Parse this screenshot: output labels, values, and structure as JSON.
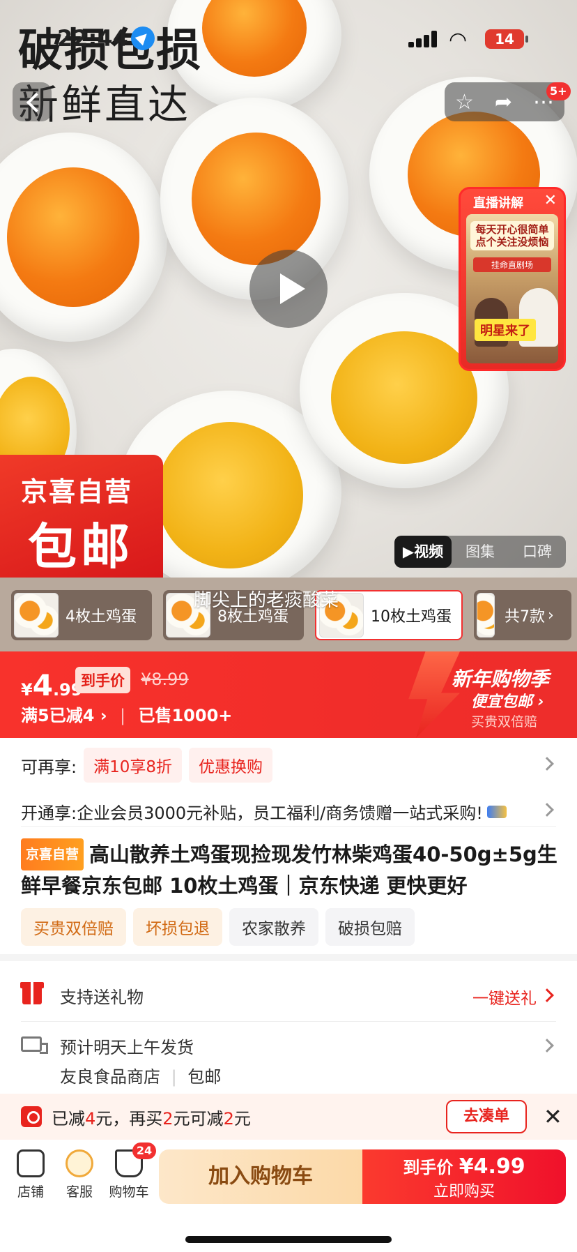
{
  "status_bar": {
    "time": "22:44",
    "battery": "14"
  },
  "hero": {
    "title_line1": "破损包损",
    "title_line2": "新鲜直达",
    "badge_count": "5+",
    "live_card": {
      "header": "直播讲解",
      "tag1": "每天开心很简单 点个关注没烦恼",
      "tag2": "挂命直剧场",
      "banner": "明星来了"
    },
    "promo_badge_line1": "京喜自营",
    "promo_badge_line2": "包邮",
    "media_tabs": [
      "▶视频",
      "图集",
      "口碑"
    ]
  },
  "variants": {
    "items": [
      "4枚土鸡蛋",
      "8枚土鸡蛋",
      "10枚土鸡蛋"
    ],
    "more": "共7款",
    "overlay_text": "脚尖上的老痰酸菜"
  },
  "price": {
    "currency": "¥",
    "integer": "4",
    "decimal": ".99",
    "tag": "到手价",
    "original": "¥8.99",
    "discount_rule": "满5已减4",
    "sold": "已售1000+",
    "festival_title": "新年购物季",
    "festival_sub": "便宜包邮",
    "festival_sub2": "买贵双倍赔"
  },
  "info": {
    "benefit_label": "可再享:",
    "benefit_pills": [
      "满10享8折",
      "优惠换购"
    ],
    "vip_text": "开通享:企业会员3000元补贴，员工福利/商务馈赠一站式采购!",
    "title_tag": "京喜自营",
    "title": "高山散养土鸡蛋现捡现发竹林柴鸡蛋40-50g±5g生鲜早餐京东包邮 10枚土鸡蛋｜京东快递 更快更好",
    "feature_tags": [
      "买贵双倍赔",
      "坏损包退",
      "农家散养",
      "破损包赔"
    ]
  },
  "service": {
    "gift_label": "支持送礼物",
    "gift_action": "一键送礼",
    "ship_label": "预计明天上午发货",
    "store": "友良食品商店",
    "shipping_fee": "包邮"
  },
  "coupon": {
    "text_prefix": "已减",
    "amount1": "4",
    "text_mid": "元，再买",
    "amount2": "2",
    "text_mid2": "元可减",
    "amount3": "2",
    "text_suffix": "元",
    "button": "去凑单"
  },
  "bottom": {
    "store": "店铺",
    "service": "客服",
    "cart": "购物车",
    "cart_count": "24",
    "add_cart": "加入购物车",
    "buy_price_label": "到手价",
    "buy_price": "¥4.99",
    "buy_now": "立即购买"
  },
  "colors": {
    "accent": "#f23030",
    "orange": "#ff8a1f"
  }
}
